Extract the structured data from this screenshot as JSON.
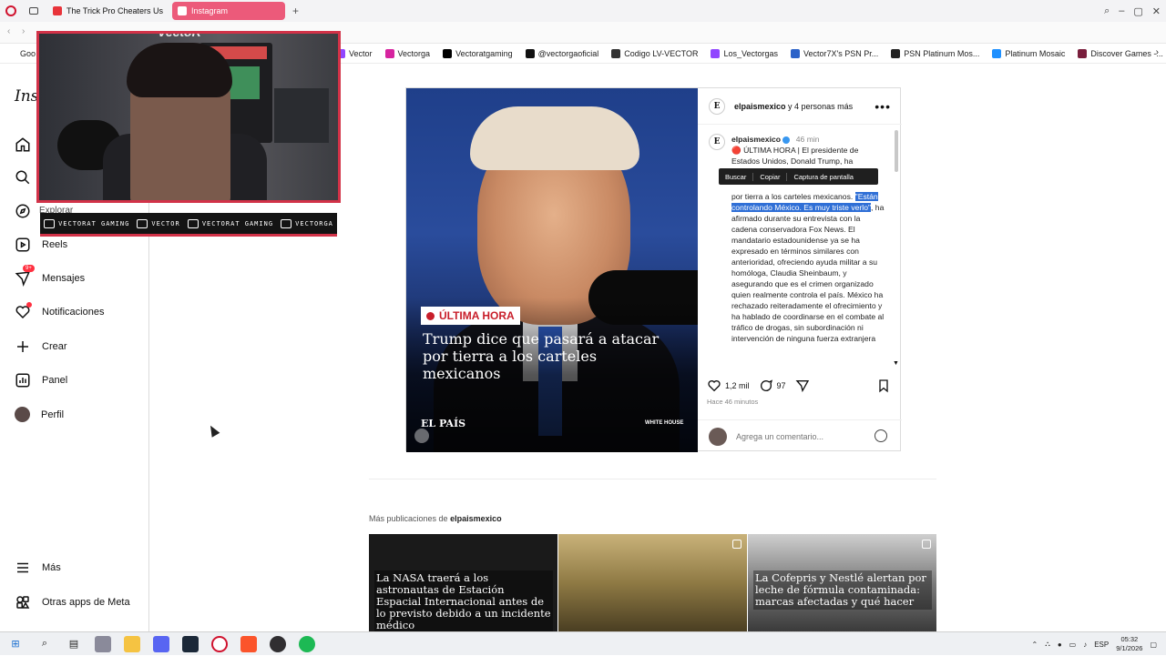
{
  "browser": {
    "tabs": [
      {
        "label": "The Trick Pro Cheaters Us",
        "active": false,
        "color": "#e8333a"
      },
      {
        "label": "Instagram",
        "active": true,
        "color": "#d6249f"
      }
    ],
    "bookmarks": [
      {
        "label": "Vector",
        "icon": "twitch-icon",
        "color": "#9146ff"
      },
      {
        "label": "Vectorga",
        "icon": "instagram-icon",
        "color": "#d6249f"
      },
      {
        "label": "Vectoratgaming",
        "icon": "x-icon",
        "color": "#000000"
      },
      {
        "label": "@vectorgaoficial",
        "icon": "tiktok-icon",
        "color": "#111111"
      },
      {
        "label": "Codigo LV-VECTOR",
        "icon": "tag-icon",
        "color": "#333333"
      },
      {
        "label": "Los_Vectorgas",
        "icon": "twitch-icon",
        "color": "#9146ff"
      },
      {
        "label": "Vector7X's PSN Pr...",
        "icon": "psn-icon",
        "color": "#2b62c8"
      },
      {
        "label": "PSN Platinum Mos...",
        "icon": "psn-icon",
        "color": "#222222"
      },
      {
        "label": "Platinum Mosaic",
        "icon": "globe-icon",
        "color": "#1e90ff"
      },
      {
        "label": "Discover Games -...",
        "icon": "game-icon",
        "color": "#7a1f3d"
      }
    ],
    "partial_bookmark": "Goo"
  },
  "sidebar": {
    "logo": "Ins",
    "items": [
      {
        "label": "Explorar",
        "icon": "compass-icon"
      },
      {
        "label": "Reels",
        "icon": "reels-icon"
      },
      {
        "label": "Mensajes",
        "icon": "messenger-icon",
        "badge": "9+"
      },
      {
        "label": "Notificaciones",
        "icon": "heart-icon"
      },
      {
        "label": "Crear",
        "icon": "plus-icon"
      },
      {
        "label": "Panel",
        "icon": "chart-icon"
      },
      {
        "label": "Perfil",
        "icon": "avatar-icon"
      }
    ],
    "bottom": [
      {
        "label": "Más",
        "icon": "menu-icon"
      },
      {
        "label": "Otras apps de Meta",
        "icon": "meta-apps-icon"
      }
    ]
  },
  "overlay": {
    "watermark": "VectoR",
    "socials": [
      {
        "label": "VECTORAT GAMING",
        "icon": "youtube-icon"
      },
      {
        "label": "VECTOR",
        "icon": "twitch-icon"
      },
      {
        "label": "VECTORAT GAMING",
        "icon": "twitter-icon"
      },
      {
        "label": "VECTORGA",
        "icon": "instagram-icon"
      }
    ]
  },
  "post": {
    "image": {
      "badge": "ÚLTIMA HORA",
      "headline": "Trump dice que pasará a atacar por tierra a los carteles mexicanos",
      "source": "EL PAÍS",
      "credit": "WHITE HOUSE"
    },
    "header": {
      "account": "elpaismexico",
      "others": "y 4 personas más"
    },
    "caption": {
      "account": "elpaismexico",
      "time": "46 min",
      "text_before": "🔴 ÚLTIMA HORA | El presidente de Estados Unidos, Donald Trump, ha",
      "text_mid": "por tierra a los carteles mexicanos.",
      "highlight": "\"Están controlando México. Es muy triste verlo\"",
      "text_after": ", ha afirmado durante su entrevista con la cadena conservadora Fox News. El mandatario estadounidense ya se ha expresado en términos similares con anterioridad, ofreciendo ayuda militar a su homóloga, Claudia Sheinbaum, y asegurando que es el crimen organizado quien realmente controla el país. México ha rechazado reiteradamente el ofrecimiento y ha hablado de coordinarse en el combate al tráfico de drogas, sin subordinación ni intervención de ninguna fuerza extranjera"
    },
    "context_menu": [
      "Buscar",
      "Copiar",
      "Captura de pantalla"
    ],
    "likes": "1,2 mil",
    "comments": "97",
    "ago": "Hace 46 minutos",
    "comment_placeholder": "Agrega un comentario..."
  },
  "more": {
    "prefix": "Más publicaciones de",
    "account": "elpaismexico",
    "thumbs": [
      {
        "caption": "La NASA traerá a los astronautas de Estación Espacial Internacional antes de lo previsto debido a un incidente médico",
        "bg": "#1a1a1a"
      },
      {
        "caption": "",
        "bg": "#b89a60"
      },
      {
        "caption": "La Cofepris y Nestlé alertan por leche de fórmula contaminada: marcas afectadas y qué hacer",
        "bg": "#6a6a6a"
      }
    ]
  },
  "taskbar": {
    "lang": "ESP",
    "time": "05:32",
    "date": "9/1/2026"
  }
}
